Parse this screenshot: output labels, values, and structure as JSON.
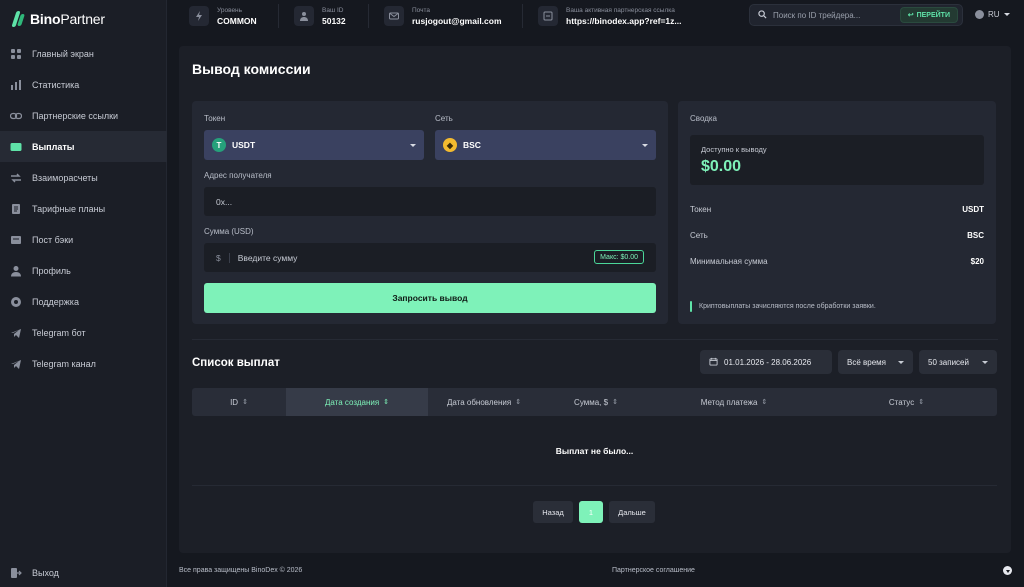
{
  "brand": {
    "name_bold": "Bino",
    "name_light": "Partner"
  },
  "sidebar": {
    "items": [
      {
        "label": "Главный экран",
        "icon": "grid-icon"
      },
      {
        "label": "Статистика",
        "icon": "chart-icon"
      },
      {
        "label": "Партнерские ссылки",
        "icon": "link-icon"
      },
      {
        "label": "Выплаты",
        "icon": "wallet-icon"
      },
      {
        "label": "Взаиморасчеты",
        "icon": "exchange-icon"
      },
      {
        "label": "Тарифные планы",
        "icon": "document-icon"
      },
      {
        "label": "Пост бэки",
        "icon": "postback-icon"
      },
      {
        "label": "Профиль",
        "icon": "user-icon"
      },
      {
        "label": "Поддержка",
        "icon": "support-icon"
      },
      {
        "label": "Telegram бот",
        "icon": "telegram-icon"
      },
      {
        "label": "Telegram канал",
        "icon": "telegram-icon"
      }
    ],
    "active_index": 3,
    "logout_label": "Выход"
  },
  "topbar": {
    "level": {
      "label": "Уровень",
      "value": "COMMON"
    },
    "user_id": {
      "label": "Ваш ID",
      "value": "50132"
    },
    "email": {
      "label": "Почта",
      "value": "rusjogout@gmail.com"
    },
    "ref_link": {
      "label": "Ваша активная партнерская ссылка",
      "value": "https://binodex.app?ref=1z..."
    },
    "search_placeholder": "Поиск по ID трейдера...",
    "go_label": "ПЕРЕЙТИ",
    "language": "RU"
  },
  "page": {
    "title": "Вывод комиссии"
  },
  "form": {
    "token_label": "Токен",
    "token_value": "USDT",
    "network_label": "Сеть",
    "network_value": "BSC",
    "address_label": "Адрес получателя",
    "address_placeholder": "0x...",
    "amount_label": "Сумма (USD)",
    "amount_prefix": "$",
    "amount_placeholder": "Введите сумму",
    "max_badge": "Макс: $0.00",
    "submit_label": "Запросить вывод"
  },
  "summary": {
    "title": "Сводка",
    "available_label": "Доступно к выводу",
    "available_value": "$0.00",
    "rows": [
      {
        "key": "Токен",
        "value": "USDT"
      },
      {
        "key": "Сеть",
        "value": "BSC"
      },
      {
        "key": "Минимальная сумма",
        "value": "$20"
      }
    ],
    "note": "Криптовыплаты зачисляются после обработки заявки."
  },
  "payouts": {
    "title": "Список выплат",
    "date_range": "01.01.2026 - 28.06.2026",
    "period_filter": "Всё время",
    "page_size": "50 записей",
    "columns": [
      "ID",
      "Дата создания",
      "Дата обновления",
      "Сумма, $",
      "Метод платежа",
      "Статус"
    ],
    "sort_glyph": "⇕",
    "active_column_index": 1,
    "empty_text": "Выплат не было...",
    "pager": {
      "prev": "Назад",
      "current": "1",
      "next": "Дальше"
    }
  },
  "footer": {
    "copyright": "Все права защищены BinoDex © 2026",
    "agreement": "Партнерское соглашение"
  },
  "colors": {
    "accent": "#7ef2b9",
    "select_bg": "#3a4160",
    "tether": "#26a17b",
    "bnb": "#f3ba2f"
  }
}
